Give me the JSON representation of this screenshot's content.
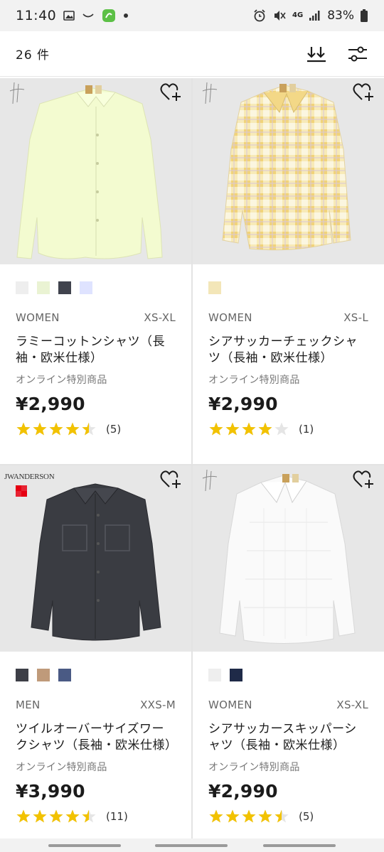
{
  "status_bar": {
    "time": "11:40",
    "network": "4G",
    "battery": "83%"
  },
  "header": {
    "count_label": "26 件",
    "sort_icon": "sort-icon",
    "filter_icon": "filter-icon"
  },
  "products": [
    {
      "gender": "WOMEN",
      "sizes": "XS-XL",
      "name": "ラミーコットンシャツ（長袖・欧米仕様）",
      "note": "オンライン特別商品",
      "price": "¥2,990",
      "rating": 4.5,
      "reviews": "(5)",
      "swatches": [
        "#eeeeee",
        "#eaf3d3",
        "#40434d",
        "#dfe3ff"
      ],
      "image_bg": "#e8e8e8",
      "garment_color": "#f4fbd2"
    },
    {
      "gender": "WOMEN",
      "sizes": "XS-L",
      "name": "シアサッカーチェックシャツ（長袖・欧米仕様）",
      "note": "オンライン特別商品",
      "price": "¥2,990",
      "rating": 4,
      "reviews": "(1)",
      "swatches": [
        "#f3e6b8"
      ],
      "image_bg": "#e8e8e8",
      "garment_color": "#f6e7b2"
    },
    {
      "gender": "MEN",
      "sizes": "XXS-M",
      "name": "ツイルオーバーサイズワークシャツ（長袖・欧米仕様）",
      "note": "オンライン特別商品",
      "price": "¥3,990",
      "rating": 4.5,
      "reviews": "(11)",
      "swatches": [
        "#3d3f47",
        "#bf9a7a",
        "#4a5a84"
      ],
      "image_bg": "#e8e8e8",
      "garment_color": "#383a40",
      "brand_text": "JWANDERSON"
    },
    {
      "gender": "WOMEN",
      "sizes": "XS-XL",
      "name": "シアサッカースキッパーシャツ（長袖・欧米仕様）",
      "note": "オンライン特別商品",
      "price": "¥2,990",
      "rating": 4.5,
      "reviews": "(5)",
      "swatches": [
        "#eeeeee",
        "#1f2a48"
      ],
      "image_bg": "#e8e8e8",
      "garment_color": "#fafafa"
    }
  ],
  "colors": {
    "star": "#f2c200",
    "star_empty": "#e5e5e5",
    "accent_red": "#e60012"
  }
}
